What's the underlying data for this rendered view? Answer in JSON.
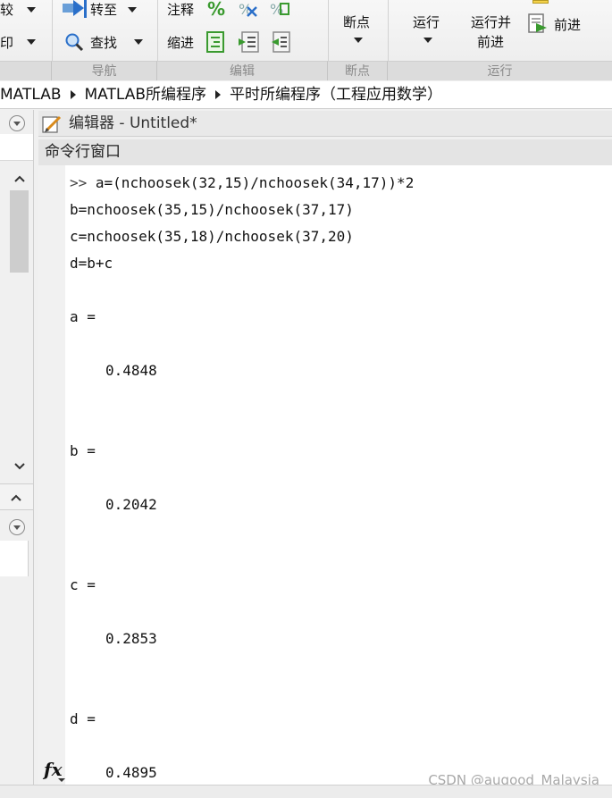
{
  "ribbon": {
    "left_items": [
      "较",
      "印"
    ],
    "nav_items": [
      "转至",
      "查找"
    ],
    "edit_items": [
      "注释",
      "缩进"
    ],
    "breakpoint_label": "断点",
    "run_label": "运行",
    "run_advance_label": [
      "运行并",
      "前进"
    ],
    "advance_label": "前进",
    "groups": [
      "导航",
      "编辑",
      "断点",
      "运行"
    ]
  },
  "address": {
    "crumbs": [
      "MATLAB",
      "MATLAB所编程序",
      "平时所编程序（工程应用数学）"
    ]
  },
  "editor": {
    "title": "编辑器 - Untitled*"
  },
  "command_window": {
    "title": "命令行窗口",
    "prompt": ">>",
    "lines": [
      "a=(nchoosek(32,15)/nchoosek(34,17))*2",
      "b=nchoosek(35,15)/nchoosek(37,17)",
      "c=nchoosek(35,18)/nchoosek(37,20)",
      "d=b+c"
    ],
    "results": [
      {
        "label": "a =",
        "value": "0.4848"
      },
      {
        "label": "b =",
        "value": "0.2042"
      },
      {
        "label": "c =",
        "value": "0.2853"
      },
      {
        "label": "d =",
        "value": "0.4895"
      }
    ],
    "fx_icon": "fx-icon"
  },
  "watermark": "CSDN @augood_Malaysia",
  "colors": {
    "accent_green": "#3a9a2f",
    "accent_blue": "#2a6fc9"
  }
}
